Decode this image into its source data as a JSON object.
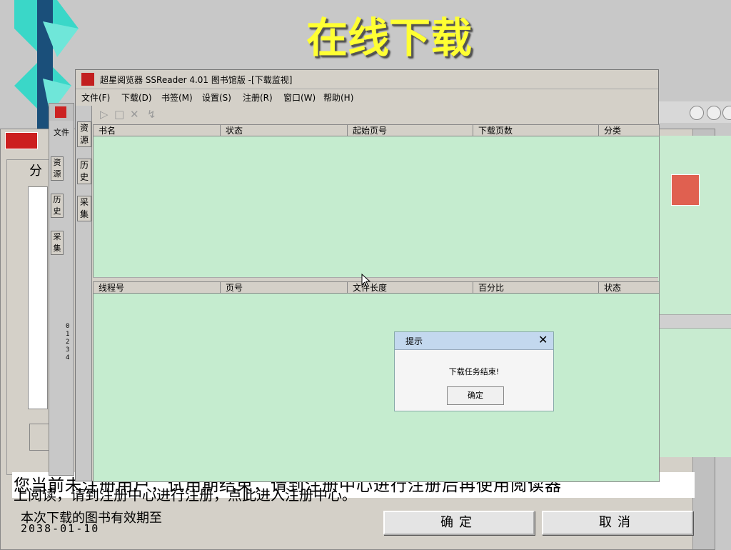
{
  "slide_title": "在线下载",
  "background_dialog": {
    "label_partial": "分",
    "notice_line1": "您当前未注册用户，试用期结束，请到注册中心进行注册后再使用阅读器",
    "notice_line2": "上阅读，请到注册中心进行注册，点此进入注册中心。",
    "validity_label": "本次下载的图书有效期至",
    "validity_date": "2038-01-10",
    "ok_button": "确定",
    "cancel_button": "取消"
  },
  "main_window": {
    "title": "超星阅览器 SSReader 4.01 图书馆版 -[下载监视]",
    "menu": [
      "文件(F)",
      "下载(D)",
      "书签(M)",
      "设置(S)",
      "注册(R)",
      "窗口(W)",
      "帮助(H)"
    ],
    "side_tabs": [
      {
        "label": "资源"
      },
      {
        "label": "历史"
      },
      {
        "label": "采集"
      }
    ],
    "task_columns": [
      "书名",
      "状态",
      "起始页号",
      "下载页数",
      "分类"
    ],
    "thread_columns": [
      "线程号",
      "页号",
      "文件长度",
      "百分比",
      "状态"
    ]
  },
  "second_window": {
    "menu_partial": "文件",
    "side_tabs": [
      "资源",
      "历史",
      "采集"
    ],
    "thread_ids": [
      "0",
      "1",
      "2",
      "3",
      "4"
    ]
  },
  "popup": {
    "title": "提示",
    "message": "下载任务结束!",
    "ok_button": "确定"
  },
  "colors": {
    "title_yellow": "#ffff33",
    "grid_green": "#c5eccf",
    "popup_header": "#c3d8ee",
    "logo_red": "#c21f1f"
  }
}
